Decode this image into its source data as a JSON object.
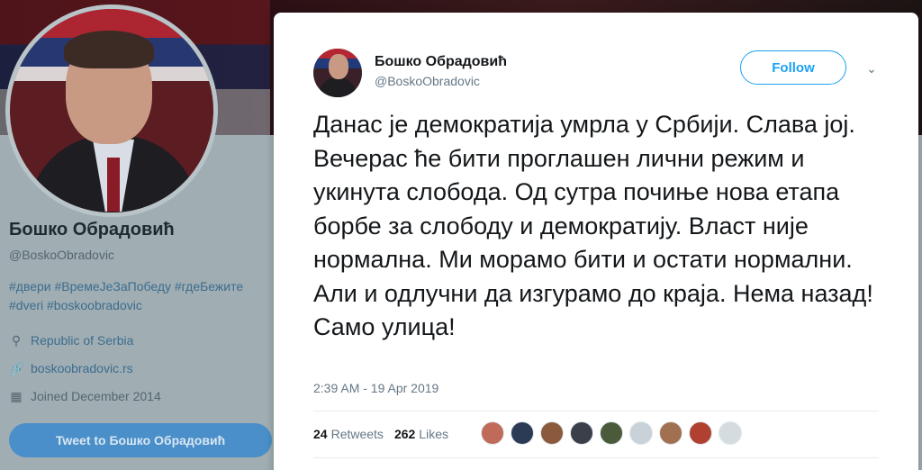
{
  "profile": {
    "name": "Бошко Обрадовић",
    "handle": "@BoskoObradovic",
    "hashtags_line1": "#двери #ВремеЈеЗаПобеду #гдеБежите",
    "hashtags_line2": "#dveri #boskoobradovic",
    "location": "Republic of Serbia",
    "website": "boskoobradovic.rs",
    "joined": "Joined December 2014",
    "tweet_to_label": "Tweet to Бошко Обрадовић",
    "icons": [
      "location-pin-icon",
      "link-icon",
      "calendar-icon"
    ]
  },
  "tweet": {
    "author_name": "Бошко Обрадовић",
    "author_handle": "@BoskoObradovic",
    "follow_label": "Follow",
    "text": "Данас је демократија умрла у Србији. Слава јој. Вечерас ће бити проглашен лични режим и укинута слобода. Од сутра почиње нова етапа борбе за слободу и демократију. Власт није нормална. Ми морамо бити и остати нормални. Али и одлучни да изгурамо до краја. Нема назад! Само улица!",
    "timestamp": "2:39 AM - 19 Apr 2019",
    "retweets_count": "24",
    "retweets_label": "Retweets",
    "likes_count": "262",
    "likes_label": "Likes",
    "liker_colors": [
      "#c06a5a",
      "#2b3a55",
      "#8b5a3c",
      "#3a3f4a",
      "#4b5a3a",
      "#c9d2d8",
      "#a07050",
      "#b04030",
      "#d5dce0"
    ]
  },
  "colors": {
    "accent": "#1da1f2",
    "link": "#3c6c8e",
    "tweet_to_button": "#4a8fc9"
  }
}
